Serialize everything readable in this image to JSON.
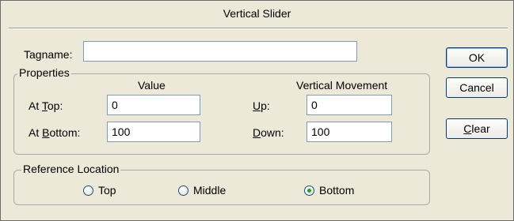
{
  "window": {
    "title": "Vertical Slider"
  },
  "tagname": {
    "label": "Tagname:",
    "value": ""
  },
  "properties": {
    "legend": "Properties",
    "value_header": "Value",
    "movement_header": "Vertical Movement",
    "at_top": {
      "prefix": "At ",
      "accel": "T",
      "suffix": "op:",
      "value": "0"
    },
    "at_bottom": {
      "prefix": "At ",
      "accel": "B",
      "suffix": "ottom:",
      "value": "100"
    },
    "up": {
      "accel": "U",
      "suffix": "p:",
      "value": "0"
    },
    "down": {
      "accel": "D",
      "suffix": "own:",
      "value": "100"
    }
  },
  "reference_location": {
    "legend": "Reference Location",
    "options": [
      {
        "label": "Top",
        "checked": false
      },
      {
        "label": "Middle",
        "checked": false
      },
      {
        "label": "Bottom",
        "checked": true
      }
    ]
  },
  "buttons": {
    "ok": "OK",
    "cancel": "Cancel",
    "clear": {
      "accel": "C",
      "suffix": "lear"
    }
  },
  "colors": {
    "dialog_bg": "#ece9d8",
    "radio_selected": "#21a121",
    "button_border": "#003c74"
  }
}
